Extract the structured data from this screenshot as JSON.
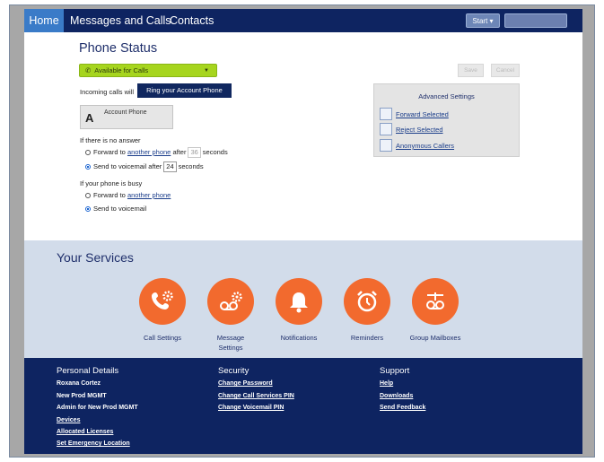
{
  "nav": {
    "home": "Home",
    "messages": "Messages and Calls",
    "contacts": "Contacts",
    "start": "Start ▾"
  },
  "phone_status": {
    "title": "Phone Status",
    "availability": "Available for Calls",
    "incoming_label": "Incoming calls will",
    "ring_button": "Ring your Account Phone",
    "account_letter": "A",
    "account_name": "Account Phone",
    "no_answer": {
      "heading": "If there is no answer",
      "forward_prefix": "Forward to",
      "forward_link": "another phone",
      "forward_after": "after",
      "forward_seconds": "36",
      "seconds_unit": "seconds",
      "voicemail_prefix": "Send to voicemail after",
      "voicemail_seconds": "24"
    },
    "busy": {
      "heading": "If your phone is busy",
      "forward_prefix": "Forward to",
      "forward_link": "another phone",
      "voicemail": "Send to voicemail"
    },
    "save_button": "Save",
    "cancel_button": "Cancel"
  },
  "advanced": {
    "title": "Advanced Settings",
    "items": [
      "Forward Selected",
      "Reject Selected",
      "Anonymous Callers"
    ]
  },
  "services": {
    "title": "Your Services",
    "items": [
      {
        "label": "Call Settings",
        "icon": "phone-gear-icon"
      },
      {
        "label": "Message Settings",
        "icon": "voicemail-gear-icon"
      },
      {
        "label": "Notifications",
        "icon": "bell-icon"
      },
      {
        "label": "Reminders",
        "icon": "alarm-clock-icon"
      },
      {
        "label": "Group Mailboxes",
        "icon": "group-voicemail-icon"
      }
    ],
    "accent_color": "#f26a2e"
  },
  "footer": {
    "personal": {
      "heading": "Personal Details",
      "name": "Roxana Cortez",
      "line2": "New Prod MGMT",
      "line3": "Admin for New Prod MGMT",
      "links": [
        "Devices",
        "Allocated Licenses",
        "Set Emergency Location"
      ]
    },
    "security": {
      "heading": "Security",
      "links": [
        "Change Password",
        "Change Call Services PIN",
        "Change Voicemail PIN"
      ]
    },
    "support": {
      "heading": "Support",
      "links": [
        "Help",
        "Downloads",
        "Send Feedback"
      ]
    }
  },
  "colors": {
    "nav_bg": "#0e2461",
    "home_tab": "#3a7bc8",
    "available_green": "#a6d51e"
  }
}
